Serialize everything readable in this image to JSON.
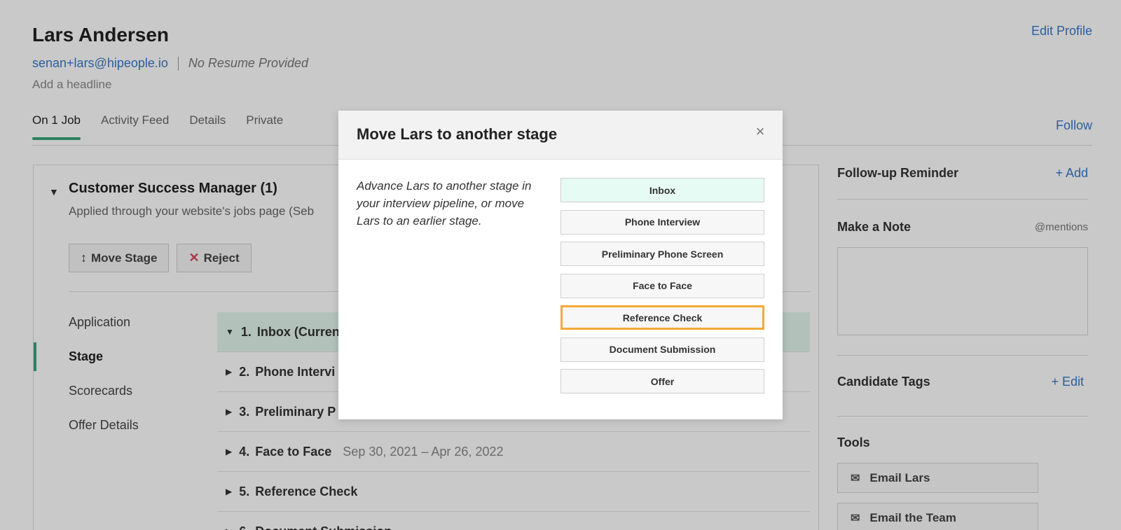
{
  "candidate": {
    "name": "Lars Andersen",
    "email": "senan+lars@hipeople.io",
    "resume_status": "No Resume Provided",
    "headline_placeholder": "Add a headline",
    "edit_profile": "Edit Profile"
  },
  "tabs": [
    {
      "label": "On 1 Job",
      "active": true
    },
    {
      "label": "Activity Feed",
      "active": false
    },
    {
      "label": "Details",
      "active": false
    },
    {
      "label": "Private",
      "active": false
    }
  ],
  "follow_label": "Follow",
  "job": {
    "title": "Customer Success Manager (1)",
    "subtitle": "Applied through your website's jobs page (Seb",
    "move_stage_label": "Move Stage",
    "reject_label": "Reject"
  },
  "sidenav": [
    {
      "label": "Application"
    },
    {
      "label": "Stage"
    },
    {
      "label": "Scorecards"
    },
    {
      "label": "Offer Details"
    }
  ],
  "stages": [
    {
      "num": "1.",
      "name": "Inbox (Curren",
      "dates": "",
      "current": true
    },
    {
      "num": "2.",
      "name": "Phone Intervi",
      "dates": ""
    },
    {
      "num": "3.",
      "name": "Preliminary P",
      "dates": ""
    },
    {
      "num": "4.",
      "name": "Face to Face",
      "dates": "Sep 30, 2021 – Apr 26, 2022"
    },
    {
      "num": "5.",
      "name": "Reference Check",
      "dates": ""
    },
    {
      "num": "6.",
      "name": "Document Submission",
      "dates": ""
    }
  ],
  "right": {
    "followup": {
      "title": "Follow-up Reminder",
      "action": "+ Add"
    },
    "note": {
      "title": "Make a Note",
      "hint": "@mentions"
    },
    "tags": {
      "title": "Candidate Tags",
      "action": "+ Edit"
    },
    "tools": {
      "title": "Tools",
      "email_candidate": "Email Lars",
      "email_team": "Email the Team"
    }
  },
  "modal": {
    "title": "Move Lars to another stage",
    "description": "Advance Lars to another stage in your interview pipeline, or move Lars to an earlier stage.",
    "stages": [
      {
        "label": "Inbox",
        "state": "current"
      },
      {
        "label": "Phone Interview",
        "state": ""
      },
      {
        "label": "Preliminary Phone Screen",
        "state": ""
      },
      {
        "label": "Face to Face",
        "state": ""
      },
      {
        "label": "Reference Check",
        "state": "focused"
      },
      {
        "label": "Document Submission",
        "state": ""
      },
      {
        "label": "Offer",
        "state": ""
      }
    ]
  },
  "colors": {
    "accent_green": "#3aa57a",
    "link_blue": "#3a78c8",
    "focus_orange": "#f4a93b",
    "current_stage_bg": "#e6fbf4"
  }
}
